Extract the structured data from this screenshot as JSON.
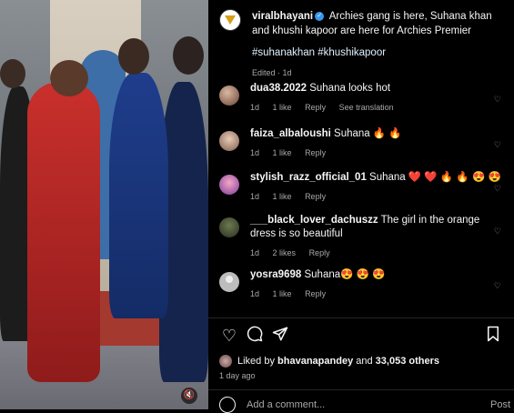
{
  "post": {
    "username": "viralbhayani",
    "caption": "Archies gang is here, Suhana khan and khushi kapoor are here for Archies Premier",
    "hashtags": "#suhanakhan #khushikapoor",
    "edited": "Edited · 1d"
  },
  "comments": [
    {
      "user": "dua38.2022",
      "text": "Suhana looks hot",
      "time": "1d",
      "likes": "1 like",
      "reply": "Reply",
      "extra": "See translation"
    },
    {
      "user": "faiza_albaloushi",
      "text": "Suhana 🔥 🔥",
      "time": "1d",
      "likes": "1 like",
      "reply": "Reply",
      "extra": ""
    },
    {
      "user": "stylish_razz_official_01",
      "text": "Suhana ❤️ ❤️ 🔥 🔥 😍 😍",
      "time": "1d",
      "likes": "1 like",
      "reply": "Reply",
      "extra": ""
    },
    {
      "user": "___black_lover_dachuszz",
      "text": "The girl in the orange dress is so beautiful",
      "time": "1d",
      "likes": "2 likes",
      "reply": "Reply",
      "extra": ""
    },
    {
      "user": "yosra9698",
      "text": "Suhana😍 😍 😍",
      "time": "1d",
      "likes": "1 like",
      "reply": "Reply",
      "extra": ""
    }
  ],
  "likes": {
    "prefix": "Liked by",
    "user": "bhavanapandey",
    "connector": "and",
    "others": "33,053 others"
  },
  "time_ago": "1 day ago",
  "add_comment_placeholder": "Add a comment...",
  "post_button": "Post",
  "icons": {
    "like": "heart-icon",
    "comment": "comment-icon",
    "share": "send-icon",
    "save": "bookmark-icon",
    "emoji": "emoji-icon",
    "mute": "mute-icon",
    "verified": "verified-badge-icon"
  },
  "colors": {
    "verified": "#3897f0",
    "muted": "#a8a8a8",
    "background": "#000000"
  }
}
